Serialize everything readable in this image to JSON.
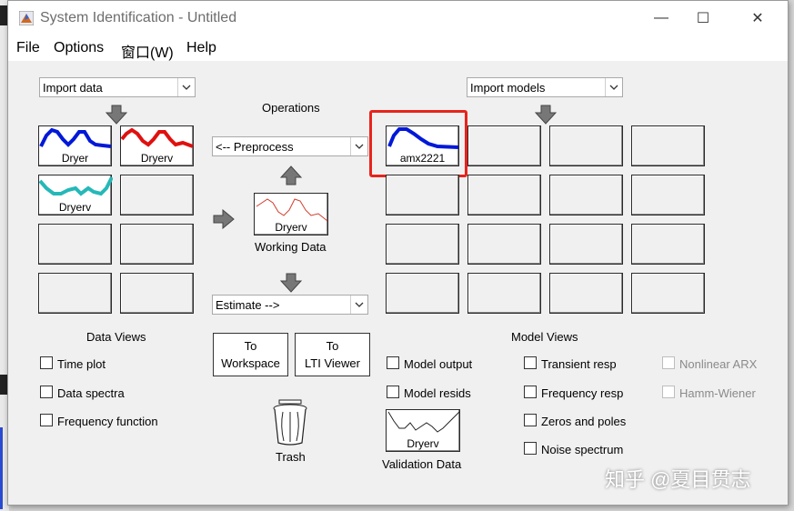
{
  "window": {
    "title": "System Identification - Untitled",
    "minimize": "—",
    "maximize": "☐",
    "close": "✕"
  },
  "menu": [
    "File",
    "Options",
    "窗口(W)",
    "Help"
  ],
  "import_data": {
    "selected": "Import data"
  },
  "import_models": {
    "selected": "Import models"
  },
  "data_tiles": [
    "Dryer",
    "Dryerv",
    "Dryerv"
  ],
  "model_tiles": [
    "amx2221"
  ],
  "operations": {
    "title": "Operations",
    "preprocess": "<-- Preprocess",
    "working_data_tile": "Dryerv",
    "working_data_label": "Working Data",
    "estimate": "Estimate -->"
  },
  "data_views": {
    "title": "Data Views",
    "items": [
      "Time plot",
      "Data spectra",
      "Frequency function"
    ]
  },
  "buttons": {
    "to_workspace": [
      "To",
      "Workspace"
    ],
    "to_lti": [
      "To",
      "LTI Viewer"
    ]
  },
  "trash": "Trash",
  "validation": {
    "tile": "Dryerv",
    "label": "Validation Data"
  },
  "model_views": {
    "title": "Model Views",
    "col1": [
      "Model output",
      "Model resids"
    ],
    "col2": [
      "Transient resp",
      "Frequency resp",
      "Zeros and poles",
      "Noise spectrum"
    ],
    "col3": [
      "Nonlinear ARX",
      "Hamm-Wiener"
    ]
  },
  "colors": {
    "dryer": "#0018d8",
    "dryerv_red": "#e01010",
    "dryerv_teal": "#25b8b8",
    "highlight": "#e8231c",
    "working": "#d43a2a"
  },
  "watermark": "知乎 @夏目贯志"
}
